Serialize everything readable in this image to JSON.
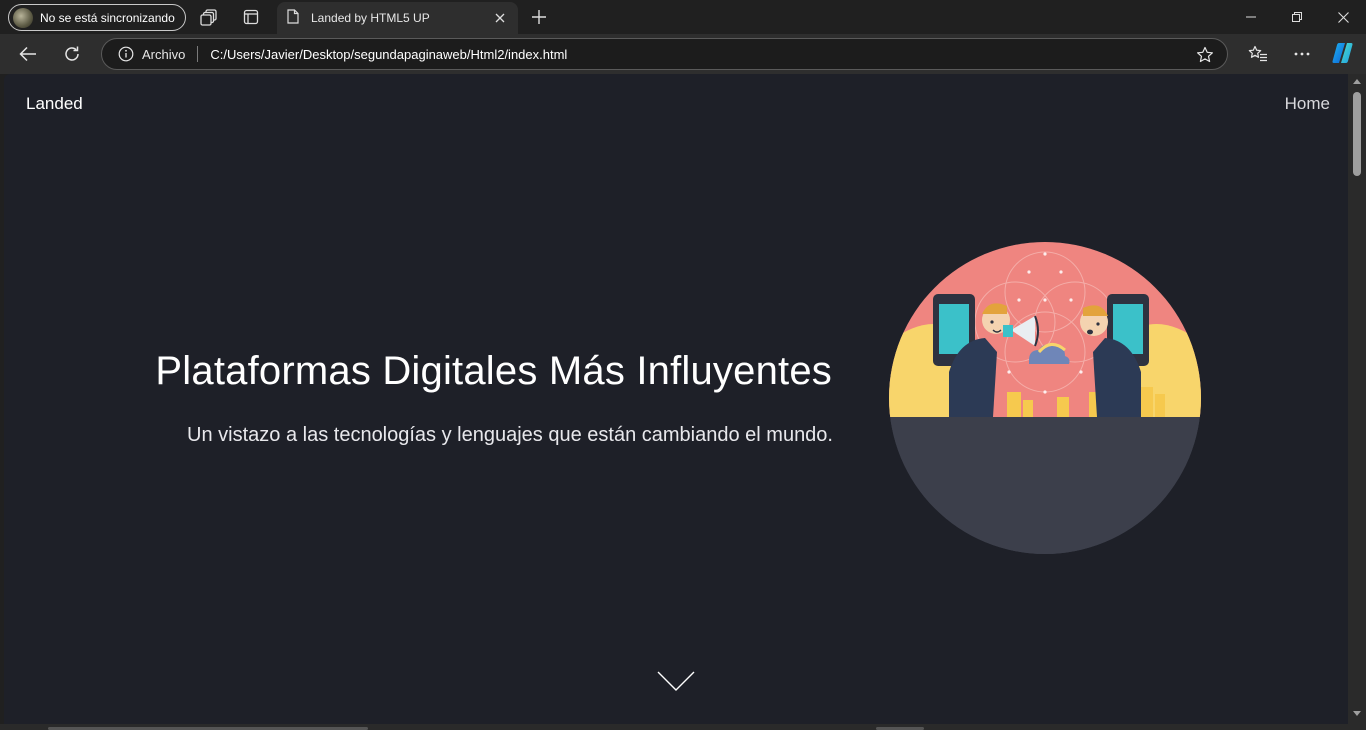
{
  "browser": {
    "profile_label": "No se está sincronizando",
    "tab_title": "Landed by HTML5 UP",
    "address_scheme": "Archivo",
    "address_url": "C:/Users/Javier/Desktop/segundapaginaweb/Html2/index.html"
  },
  "page": {
    "brand": "Landed",
    "nav_home": "Home",
    "hero_title": "Plataformas Digitales Más Influyentes",
    "hero_subtitle": "Un vistazo a las tecnologías y lenguajes que están cambiando el mundo."
  },
  "icons": {
    "workspaces": "workspaces-icon",
    "tab_actions": "tab-actions-icon",
    "document": "document-icon",
    "back": "back-arrow-icon",
    "refresh": "refresh-icon",
    "info": "info-icon",
    "favorite": "star-icon",
    "favorites_menu": "favorites-icon",
    "more": "more-icon",
    "copilot": "copilot-icon",
    "scroll_down": "chevron-down-icon"
  },
  "colors": {
    "page_background": "#1e2028",
    "circle_background": "#3c3f4b",
    "illustration_pink": "#ef8580",
    "browser_chrome": "#202020"
  }
}
